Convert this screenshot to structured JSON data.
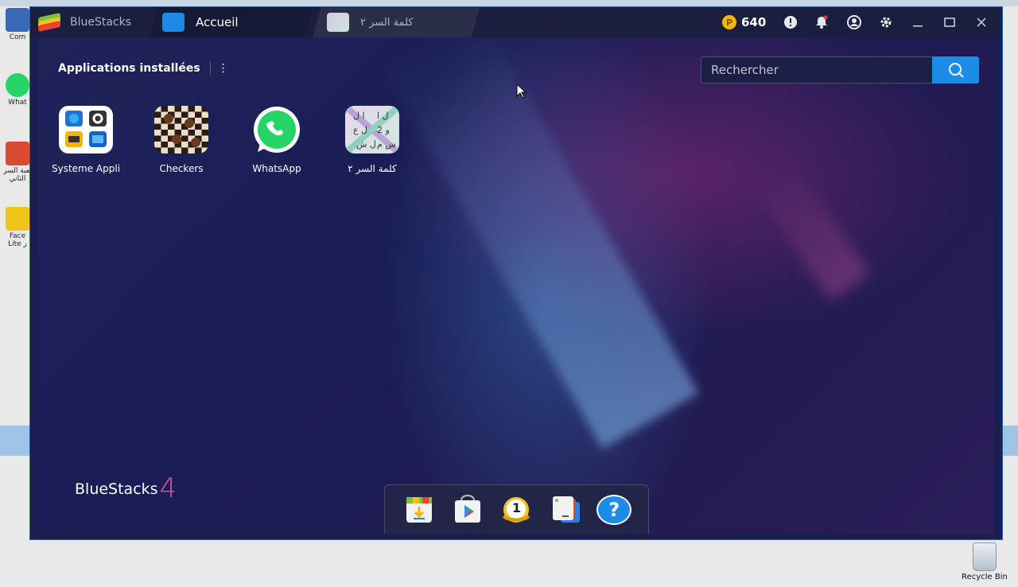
{
  "desktop": {
    "icons": [
      {
        "label": "Com",
        "color": "#3a68b8"
      },
      {
        "label": "What",
        "color": "#25d366"
      },
      {
        "label": "لعبة السر الثاني",
        "color": "#d94a2f"
      },
      {
        "label": "Face Lite ر",
        "color": "#f0c419"
      }
    ],
    "recycle_bin_label": "Recycle Bin"
  },
  "titlebar": {
    "brand_label": "BlueStacks",
    "tabs": [
      {
        "label": "Accueil",
        "active": true
      },
      {
        "label": "كلمة السر ٢",
        "active": false
      }
    ],
    "coins": "640"
  },
  "home": {
    "section_title": "Applications installées",
    "search_placeholder": "Rechercher",
    "apps": [
      {
        "label": "Systeme Appli",
        "icon": "settings-icon"
      },
      {
        "label": "Checkers",
        "icon": "checkers-icon"
      },
      {
        "label": "WhatsApp",
        "icon": "whatsapp-icon"
      },
      {
        "label": "كلمة السر ٢",
        "icon": "word-game-icon"
      }
    ],
    "brand_logo": "BlueStacks",
    "brand_version": "4"
  },
  "dock": [
    {
      "icon": "app-center-icon"
    },
    {
      "icon": "play-store-icon"
    },
    {
      "icon": "rank-badge-icon",
      "badge": "1"
    },
    {
      "icon": "multi-instance-icon"
    },
    {
      "icon": "help-icon",
      "glyph": "?"
    }
  ],
  "colors": {
    "window_bg": "#1b1f4f",
    "accent": "#1c8ce8",
    "coin": "#f5b800",
    "logo_four": "#e05596"
  }
}
